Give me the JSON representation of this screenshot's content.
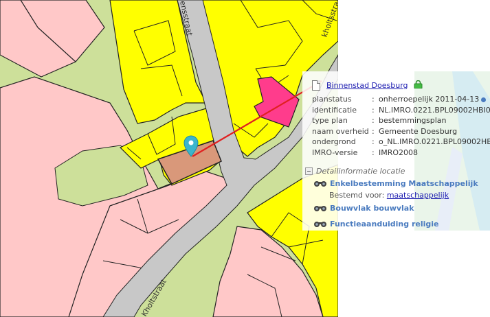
{
  "map": {
    "street_labels": [
      "ensstraat",
      "kholtsstraat",
      "Kholtstraat"
    ]
  },
  "popup": {
    "title": "Binnenstad Doesburg",
    "attributes": [
      {
        "key": "planstatus",
        "sep": ":",
        "value": "onherroepelijk 2011-04-13",
        "info": true
      },
      {
        "key": "identificatie",
        "sep": ":",
        "value": "NL.IMRO.0221.BPL09002HBI0-"
      },
      {
        "key": "type plan",
        "sep": ":",
        "value": "bestemmingsplan"
      },
      {
        "key": "naam overheid",
        "sep": ":",
        "value": "Gemeente Doesburg"
      },
      {
        "key": "ondergrond",
        "sep": ":",
        "value": "o_NL.IMRO.0221.BPL09002HB"
      },
      {
        "key": "IMRO-versie",
        "sep": ":",
        "value": "IMRO2008"
      }
    ],
    "detail_heading": "Detailinformatie locatie",
    "items": [
      {
        "label": "Enkelbestemming Maatschappelijk",
        "sub_prefix": "Bestemd voor:",
        "sub_link": "maatschappelijk"
      },
      {
        "label": "Bouwvlak bouwvlak"
      },
      {
        "label": "Functieaanduiding religie"
      }
    ]
  },
  "colors": {
    "residential": "#ffc8c8",
    "mixed": "#ffff00",
    "green": "#cde09a",
    "road": "#c8c8c8",
    "selected_parcel": "#d9987a",
    "society": "#ff3c8c",
    "marker": "#3bb5cc",
    "connector": "#e02020"
  }
}
